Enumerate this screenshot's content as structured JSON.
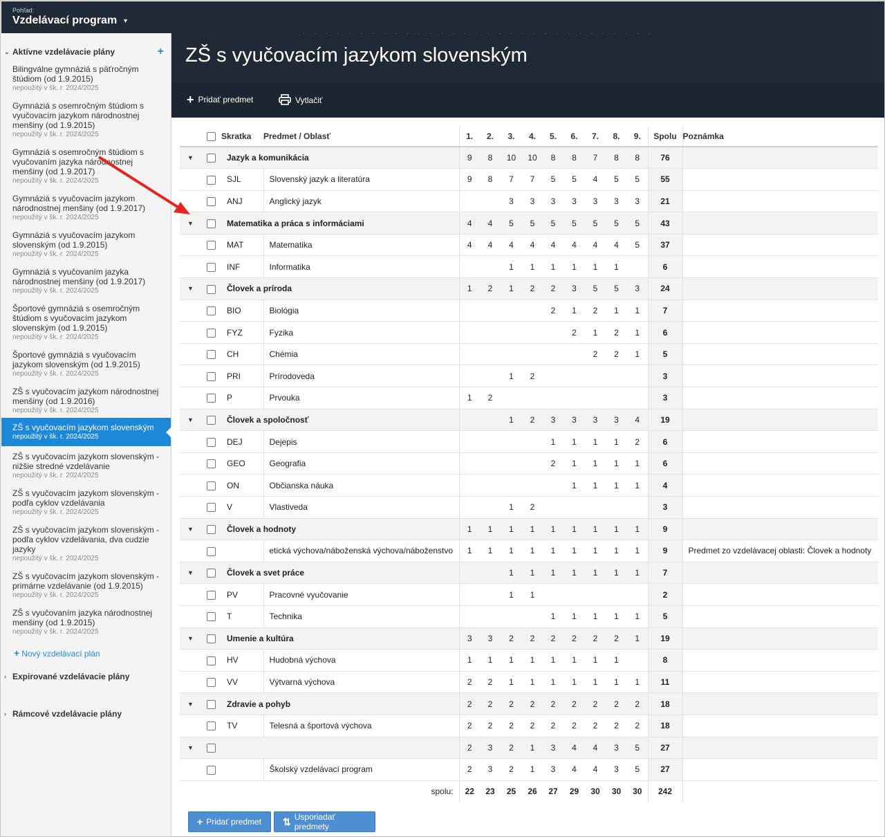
{
  "header": {
    "view_label": "Pohľad:",
    "view_value": "Vzdelávací program",
    "page_title": "ZŠ s vyučovacím jazykom slovenským"
  },
  "toolbar": {
    "add_subject": "Pridať predmet",
    "print": "Vytlačiť"
  },
  "sidebar": {
    "active_section": "Aktívne vzdelávacie plány",
    "plans": [
      {
        "name": "Bilingválne gymnáziá s päťročným štúdiom (od 1.9.2015)",
        "note": "nepoužitý v šk. r. 2024/2025"
      },
      {
        "name": "Gymnáziá s osemročným štúdiom s vyučovacím jazykom národnostnej menšiny (od 1.9.2015)",
        "note": "nepoužitý v šk. r. 2024/2025"
      },
      {
        "name": "Gymnáziá s osemročným štúdiom s vyučovaním jazyka národnostnej menšiny (od 1.9.2017)",
        "note": "nepoužitý v šk. r. 2024/2025"
      },
      {
        "name": "Gymnáziá s vyučovacím jazykom národnostnej menšiny (od 1.9.2017)",
        "note": "nepoužitý v šk. r. 2024/2025"
      },
      {
        "name": "Gymnáziá s vyučovacím jazykom slovenským (od 1.9.2015)",
        "note": "nepoužitý v šk. r. 2024/2025"
      },
      {
        "name": "Gymnáziá s vyučovaním jazyka národnostnej menšiny (od 1.9.2017)",
        "note": "nepoužitý v šk. r. 2024/2025"
      },
      {
        "name": "Športové gymnáziá s osemročným štúdiom s vyučovacím jazykom slovenským (od 1.9.2015)",
        "note": "nepoužitý v šk. r. 2024/2025"
      },
      {
        "name": "Športové gymnáziá s vyučovacím jazykom slovenským (od 1.9.2015)",
        "note": "nepoužitý v šk. r. 2024/2025"
      },
      {
        "name": "ZŠ s vyučovacím jazykom národnostnej menšiny (od 1.9.2016)",
        "note": "nepoužitý v šk. r. 2024/2025"
      },
      {
        "name": "ZŠ s vyučovacím jazykom slovenským",
        "note": "nepoužitý v šk. r. 2024/2025"
      },
      {
        "name": "ZŠ s vyučovacím jazykom slovenským - nižšie stredné vzdelávanie",
        "note": "nepoužitý v šk. r. 2024/2025"
      },
      {
        "name": "ZŠ s vyučovacím jazykom slovenským - podľa cyklov vzdelávania",
        "note": "nepoužitý v šk. r. 2024/2025"
      },
      {
        "name": "ZŠ s vyučovacím jazykom slovenským - podľa cyklov vzdelávania, dva cudzie jazyky",
        "note": "nepoužitý v šk. r. 2024/2025"
      },
      {
        "name": "ZŠ s vyučovacím jazykom slovenským - primárne vzdelávanie (od 1.9.2015)",
        "note": "nepoužitý v šk. r. 2024/2025"
      },
      {
        "name": "ZŠ s vyučovaním jazyka národnostnej menšiny (od 1.9.2015)",
        "note": "nepoužitý v šk. r. 2024/2025"
      }
    ],
    "new_plan": "Nový vzdelávací plán",
    "expired_section": "Expirované vzdelávacie plány",
    "framework_section": "Rámcové vzdelávacie plány"
  },
  "table": {
    "headers": {
      "abbr": "Skratka",
      "subject": "Predmet / Oblasť",
      "grades": [
        "1.",
        "2.",
        "3.",
        "4.",
        "5.",
        "6.",
        "7.",
        "8.",
        "9."
      ],
      "total": "Spolu",
      "note": "Poznámka"
    },
    "rows": [
      {
        "group": true,
        "abbr": "",
        "name": "Jazyk a komunikácia",
        "v": [
          "9",
          "8",
          "10",
          "10",
          "8",
          "8",
          "7",
          "8",
          "8"
        ],
        "total": "76",
        "note": ""
      },
      {
        "group": false,
        "abbr": "SJL",
        "name": "Slovenský jazyk a literatúra",
        "v": [
          "9",
          "8",
          "7",
          "7",
          "5",
          "5",
          "4",
          "5",
          "5"
        ],
        "total": "55",
        "note": ""
      },
      {
        "group": false,
        "abbr": "ANJ",
        "name": "Anglický jazyk",
        "v": [
          "",
          "",
          "3",
          "3",
          "3",
          "3",
          "3",
          "3",
          "3"
        ],
        "total": "21",
        "note": ""
      },
      {
        "group": true,
        "abbr": "",
        "name": "Matematika a práca s informáciami",
        "v": [
          "4",
          "4",
          "5",
          "5",
          "5",
          "5",
          "5",
          "5",
          "5"
        ],
        "total": "43",
        "note": ""
      },
      {
        "group": false,
        "abbr": "MAT",
        "name": "Matematika",
        "v": [
          "4",
          "4",
          "4",
          "4",
          "4",
          "4",
          "4",
          "4",
          "5"
        ],
        "total": "37",
        "note": ""
      },
      {
        "group": false,
        "abbr": "INF",
        "name": "Informatika",
        "v": [
          "",
          "",
          "1",
          "1",
          "1",
          "1",
          "1",
          "1",
          ""
        ],
        "total": "6",
        "note": ""
      },
      {
        "group": true,
        "abbr": "",
        "name": "Človek a príroda",
        "v": [
          "1",
          "2",
          "1",
          "2",
          "2",
          "3",
          "5",
          "5",
          "3"
        ],
        "total": "24",
        "note": ""
      },
      {
        "group": false,
        "abbr": "BIO",
        "name": "Biológia",
        "v": [
          "",
          "",
          "",
          "",
          "2",
          "1",
          "2",
          "1",
          "1"
        ],
        "total": "7",
        "note": ""
      },
      {
        "group": false,
        "abbr": "FYZ",
        "name": "Fyzika",
        "v": [
          "",
          "",
          "",
          "",
          "",
          "2",
          "1",
          "2",
          "1"
        ],
        "total": "6",
        "note": ""
      },
      {
        "group": false,
        "abbr": "CH",
        "name": "Chémia",
        "v": [
          "",
          "",
          "",
          "",
          "",
          "",
          "2",
          "2",
          "1"
        ],
        "total": "5",
        "note": ""
      },
      {
        "group": false,
        "abbr": "PRI",
        "name": "Prírodoveda",
        "v": [
          "",
          "",
          "1",
          "2",
          "",
          "",
          "",
          "",
          ""
        ],
        "total": "3",
        "note": ""
      },
      {
        "group": false,
        "abbr": "P",
        "name": "Prvouka",
        "v": [
          "1",
          "2",
          "",
          "",
          "",
          "",
          "",
          "",
          ""
        ],
        "total": "3",
        "note": ""
      },
      {
        "group": true,
        "abbr": "",
        "name": "Človek a spoločnosť",
        "v": [
          "",
          "",
          "1",
          "2",
          "3",
          "3",
          "3",
          "3",
          "4"
        ],
        "total": "19",
        "note": ""
      },
      {
        "group": false,
        "abbr": "DEJ",
        "name": "Dejepis",
        "v": [
          "",
          "",
          "",
          "",
          "1",
          "1",
          "1",
          "1",
          "2"
        ],
        "total": "6",
        "note": ""
      },
      {
        "group": false,
        "abbr": "GEO",
        "name": "Geografia",
        "v": [
          "",
          "",
          "",
          "",
          "2",
          "1",
          "1",
          "1",
          "1"
        ],
        "total": "6",
        "note": ""
      },
      {
        "group": false,
        "abbr": "ON",
        "name": "Občianska náuka",
        "v": [
          "",
          "",
          "",
          "",
          "",
          "1",
          "1",
          "1",
          "1"
        ],
        "total": "4",
        "note": ""
      },
      {
        "group": false,
        "abbr": "V",
        "name": "Vlastiveda",
        "v": [
          "",
          "",
          "1",
          "2",
          "",
          "",
          "",
          "",
          ""
        ],
        "total": "3",
        "note": ""
      },
      {
        "group": true,
        "abbr": "",
        "name": "Človek a hodnoty",
        "v": [
          "1",
          "1",
          "1",
          "1",
          "1",
          "1",
          "1",
          "1",
          "1"
        ],
        "total": "9",
        "note": ""
      },
      {
        "group": false,
        "abbr": "",
        "name": "etická výchova/náboženská výchova/náboženstvo",
        "v": [
          "1",
          "1",
          "1",
          "1",
          "1",
          "1",
          "1",
          "1",
          "1"
        ],
        "total": "9",
        "note": "Predmet zo vzdelávacej oblasti: Človek a hodnoty"
      },
      {
        "group": true,
        "abbr": "",
        "name": "Človek a svet práce",
        "v": [
          "",
          "",
          "1",
          "1",
          "1",
          "1",
          "1",
          "1",
          "1"
        ],
        "total": "7",
        "note": ""
      },
      {
        "group": false,
        "abbr": "PV",
        "name": "Pracovné vyučovanie",
        "v": [
          "",
          "",
          "1",
          "1",
          "",
          "",
          "",
          "",
          ""
        ],
        "total": "2",
        "note": ""
      },
      {
        "group": false,
        "abbr": "T",
        "name": "Technika",
        "v": [
          "",
          "",
          "",
          "",
          "1",
          "1",
          "1",
          "1",
          "1"
        ],
        "total": "5",
        "note": ""
      },
      {
        "group": true,
        "abbr": "",
        "name": "Umenie a kultúra",
        "v": [
          "3",
          "3",
          "2",
          "2",
          "2",
          "2",
          "2",
          "2",
          "1"
        ],
        "total": "19",
        "note": ""
      },
      {
        "group": false,
        "abbr": "HV",
        "name": "Hudobná výchova",
        "v": [
          "1",
          "1",
          "1",
          "1",
          "1",
          "1",
          "1",
          "1",
          ""
        ],
        "total": "8",
        "note": ""
      },
      {
        "group": false,
        "abbr": "VV",
        "name": "Výtvarná výchova",
        "v": [
          "2",
          "2",
          "1",
          "1",
          "1",
          "1",
          "1",
          "1",
          "1"
        ],
        "total": "11",
        "note": ""
      },
      {
        "group": true,
        "abbr": "",
        "name": "Zdravie a pohyb",
        "v": [
          "2",
          "2",
          "2",
          "2",
          "2",
          "2",
          "2",
          "2",
          "2"
        ],
        "total": "18",
        "note": ""
      },
      {
        "group": false,
        "abbr": "TV",
        "name": "Telesná a športová výchova",
        "v": [
          "2",
          "2",
          "2",
          "2",
          "2",
          "2",
          "2",
          "2",
          "2"
        ],
        "total": "18",
        "note": ""
      },
      {
        "group": true,
        "abbr": "",
        "name": "",
        "v": [
          "2",
          "3",
          "2",
          "1",
          "3",
          "4",
          "4",
          "3",
          "5"
        ],
        "total": "27",
        "note": ""
      },
      {
        "group": false,
        "abbr": "",
        "name": "Školský vzdelávací program",
        "v": [
          "2",
          "3",
          "2",
          "1",
          "3",
          "4",
          "4",
          "3",
          "5"
        ],
        "total": "27",
        "note": ""
      }
    ],
    "sum_label": "spolu:",
    "sum": [
      "22",
      "23",
      "25",
      "26",
      "27",
      "29",
      "30",
      "30",
      "30"
    ],
    "sum_total": "242"
  },
  "footer": {
    "add_subject": "Pridať predmet",
    "sort_subjects": "Usporiadať predmety"
  },
  "colors": {
    "header_bg": "#1f2a36",
    "accent": "#1e88d8",
    "button": "#4d8fd0",
    "annotation_arrow": "#e52620"
  }
}
